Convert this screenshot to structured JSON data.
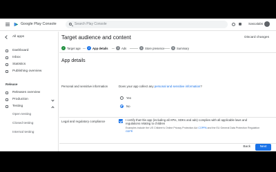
{
  "app": {
    "brand": "Google Play Console",
    "search_placeholder": "Search Play Console",
    "account": "Sascalabs"
  },
  "sidebar": {
    "back_label": "All apps",
    "items": [
      {
        "label": "Dashboard",
        "icon": "dashboard-icon"
      },
      {
        "label": "Inbox",
        "icon": "inbox-icon"
      },
      {
        "label": "Statistics",
        "icon": "statistics-icon"
      },
      {
        "label": "Publishing overview",
        "icon": "publishing-icon"
      }
    ],
    "release_heading": "Release",
    "release_items": [
      {
        "label": "Releases overview",
        "icon": "releases-icon"
      },
      {
        "label": "Production",
        "icon": "production-icon"
      },
      {
        "label": "Testing",
        "icon": "testing-icon"
      }
    ],
    "testing_sub": [
      "Open testing",
      "Closed testing",
      "Internal testing"
    ]
  },
  "main": {
    "title": "Target audience and content",
    "discard": "Discard changes",
    "steps": [
      {
        "num": "✓",
        "label": "Target age"
      },
      {
        "num": "2",
        "label": "App details"
      },
      {
        "num": "3",
        "label": "Ads"
      },
      {
        "num": "4",
        "label": "Store presence"
      },
      {
        "num": "5",
        "label": "Summary"
      }
    ],
    "section_title": "App details",
    "personal_label": "Personal and sensitive information",
    "question_prefix": "Does your app collect any ",
    "question_link": "personal and sensitive information",
    "question_suffix": "?",
    "options": [
      "Yes",
      "No"
    ],
    "selected_option": "No",
    "legal_label": "Legal and regulatory compliance",
    "certify_text": "I certify that this app (including all APIs, SDKs and ads) complies with all applicable laws and regulations relating to children",
    "example_prefix": "Examples include the US Children's Online Privacy Protection Act ",
    "example_link1": "COPPA",
    "example_mid": " and the EU General Data Protection Regulation ",
    "example_link2": "GDPR"
  },
  "footer": {
    "back": "Back",
    "next": "Next"
  },
  "colors": {
    "accent": "#1a73e8",
    "text": "#3c4043"
  }
}
